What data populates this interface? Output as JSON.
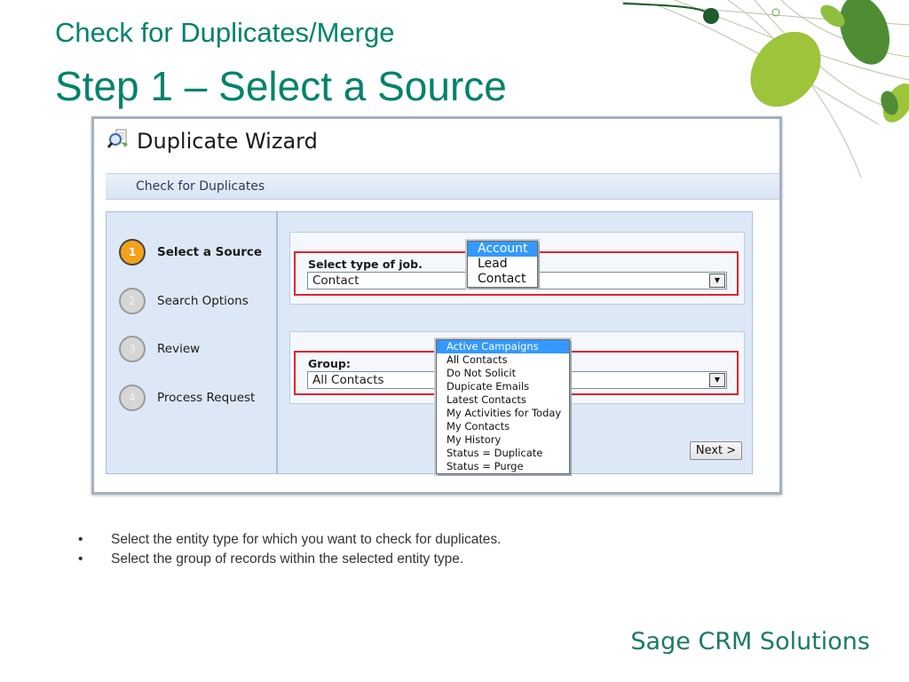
{
  "slide": {
    "title": "Check for Duplicates/Merge",
    "subtitle": "Step 1 – Select a Source",
    "brand": "Sage CRM Solutions",
    "colors": {
      "title": "#00836b",
      "leaf_light": "#9dc43b",
      "leaf_dark": "#4e8d33",
      "dot": "#1c5c2a"
    },
    "decoration_icon": "leaf-vines-decoration"
  },
  "wizard": {
    "icon": "magnifier-document-icon",
    "title": "Duplicate Wizard",
    "bar_label": "Check for Duplicates",
    "steps": [
      {
        "number": "1",
        "label": "Select a Source",
        "active": true
      },
      {
        "number": "2",
        "label": "Search Options",
        "active": false
      },
      {
        "number": "3",
        "label": "Review",
        "active": false
      },
      {
        "number": "4",
        "label": "Process Request",
        "active": false
      }
    ],
    "job_type": {
      "label": "Select type of job.",
      "value": "Contact",
      "options": [
        "Account",
        "Lead",
        "Contact"
      ],
      "highlighted": "Account"
    },
    "group": {
      "label": "Group:",
      "value": "All Contacts",
      "options": [
        "Active Campaigns",
        "All Contacts",
        "Do Not Solicit",
        "Dupicate Emails",
        "Latest Contacts",
        "My Activities for Today",
        "My Contacts",
        "My History",
        "Status = Duplicate",
        "Status = Purge"
      ],
      "highlighted": "Active Campaigns"
    },
    "next_label": "Next >",
    "accent_color": "#e0232c",
    "active_step_color": "#f4a11c"
  },
  "bullets": [
    "Select the entity type for which you want to check for duplicates.",
    "Select the group of records within the selected entity type."
  ]
}
